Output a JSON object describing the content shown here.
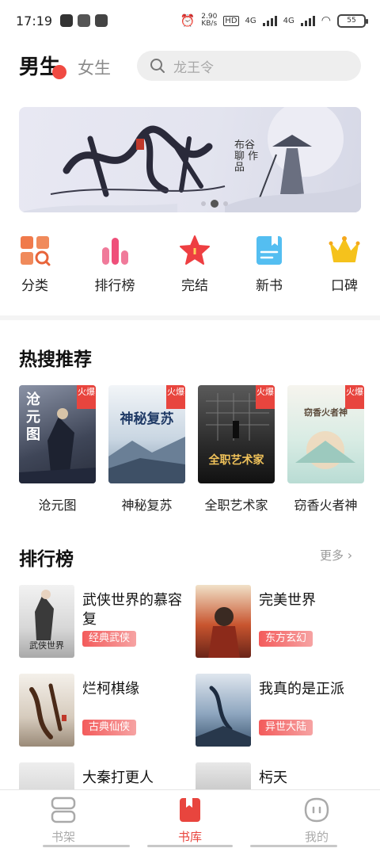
{
  "status": {
    "time": "17:19",
    "speed": "2.90\nKB/s",
    "network1": "4G",
    "network2": "4G",
    "battery": "55"
  },
  "header": {
    "tab_male": "男生",
    "tab_female": "女生",
    "search_placeholder": "龙王令"
  },
  "banner": {
    "credit": "布谷聊 作品"
  },
  "quick_links": [
    {
      "label": "分类",
      "icon": "category-icon",
      "color": "#f07a4b"
    },
    {
      "label": "排行榜",
      "icon": "ranking-icon",
      "color": "#ef4f7a"
    },
    {
      "label": "完结",
      "icon": "star-icon",
      "color": "#ee3f42"
    },
    {
      "label": "新书",
      "icon": "new-book-icon",
      "color": "#3db3ee"
    },
    {
      "label": "口碑",
      "icon": "crown-icon",
      "color": "#f5c21c"
    }
  ],
  "hot_search": {
    "title": "热搜推荐",
    "items": [
      {
        "name": "沧元图",
        "tag": "火爆",
        "cover_text": "沧元图"
      },
      {
        "name": "神秘复苏",
        "tag": "火爆",
        "cover_text": "神秘复苏"
      },
      {
        "name": "全职艺术家",
        "tag": "火爆",
        "cover_text": "全职艺术家"
      },
      {
        "name": "窃香火者神",
        "tag": "火爆",
        "cover_text": "窃香火者神"
      }
    ]
  },
  "ranking": {
    "title": "排行榜",
    "more": "更多",
    "items": [
      {
        "name": "武侠世界的慕容复",
        "genre": "经典武侠"
      },
      {
        "name": "完美世界",
        "genre": "东方玄幻"
      },
      {
        "name": "烂柯棋缘",
        "genre": "古典仙侠"
      },
      {
        "name": "我真的是正派",
        "genre": "异世大陆"
      },
      {
        "name": "大秦打更人",
        "genre": ""
      },
      {
        "name": "杇天",
        "genre": ""
      }
    ]
  },
  "bottom_nav": [
    {
      "label": "书架",
      "active": false
    },
    {
      "label": "书库",
      "active": true
    },
    {
      "label": "我的",
      "active": false
    }
  ],
  "accent_color": "#e8453e"
}
